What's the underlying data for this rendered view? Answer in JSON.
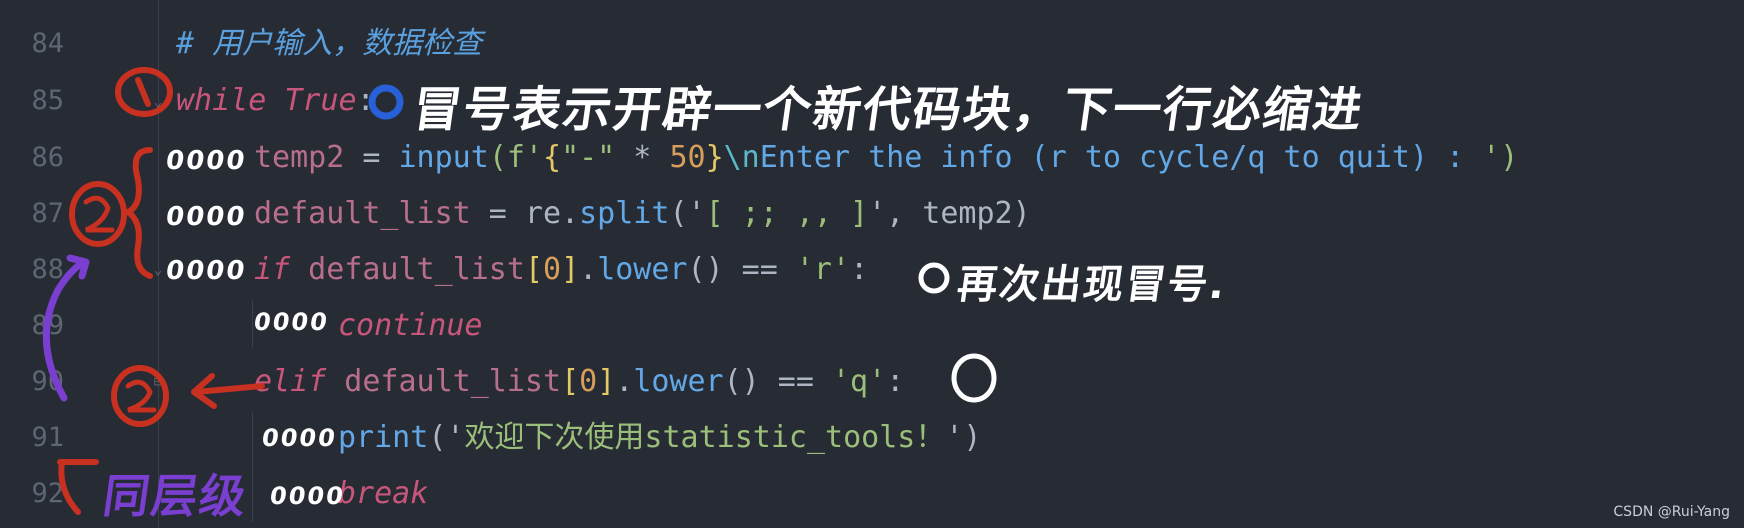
{
  "editor": {
    "line_numbers": [
      "84",
      "85",
      "86",
      "87",
      "88",
      "89",
      "90",
      "91",
      "92"
    ],
    "lines": {
      "l84": {
        "comment": "# 用户输入，数据检查"
      },
      "l85": {
        "kw": "while",
        "val": "True",
        "colon": ":"
      },
      "l86": {
        "var": "temp2",
        "eq": " = ",
        "fn": "input",
        "p1": "(f'",
        "b1": "{",
        "s1": "\"-\"",
        "op": " * ",
        "num": "50",
        "b2": "}",
        "esc": "\\n",
        "s2": "Enter the info (r to cycle/q to quit) : ",
        "end": "')"
      },
      "l87": {
        "var": "default_list",
        "eq": " = re.",
        "fn": "split",
        "p1": "('",
        "s1": "[ ;; ,, ]",
        "end": "', temp2)"
      },
      "l88": {
        "kw": "if",
        "var": " default_list",
        "b1": "[",
        "num": "0",
        "b2": "]",
        "mid": ".",
        "fn": "lower",
        "end": "() == ",
        "s1": "'r'",
        "colon": ":"
      },
      "l89": {
        "kw": "continue"
      },
      "l90": {
        "kw": "elif",
        "var": " default_list",
        "b1": "[",
        "num": "0",
        "b2": "]",
        "mid": ".",
        "fn": "lower",
        "end": "() == ",
        "s1": "'q'",
        "colon": ":"
      },
      "l91": {
        "fn": "print",
        "p1": "('",
        "s1": "欢迎下次使用statistic_tools！",
        "end": "')"
      },
      "l92": {
        "kw": "break"
      }
    }
  },
  "annotations": {
    "note_top": "冒号表示开辟一个新代码块，下一行必缩进",
    "note_mid": "再次出现冒号.",
    "note_bottom": "同层级",
    "marks": {
      "m86": "0000",
      "m87": "0000",
      "m88": "0000",
      "m89": "0000",
      "m91": "0000",
      "m92": "0000"
    },
    "colors": {
      "red": "#c8301f",
      "blue": "#2860d8",
      "purple": "#7a3fd1",
      "white": "#ffffff"
    }
  },
  "watermark": "CSDN @Rui-Yang"
}
